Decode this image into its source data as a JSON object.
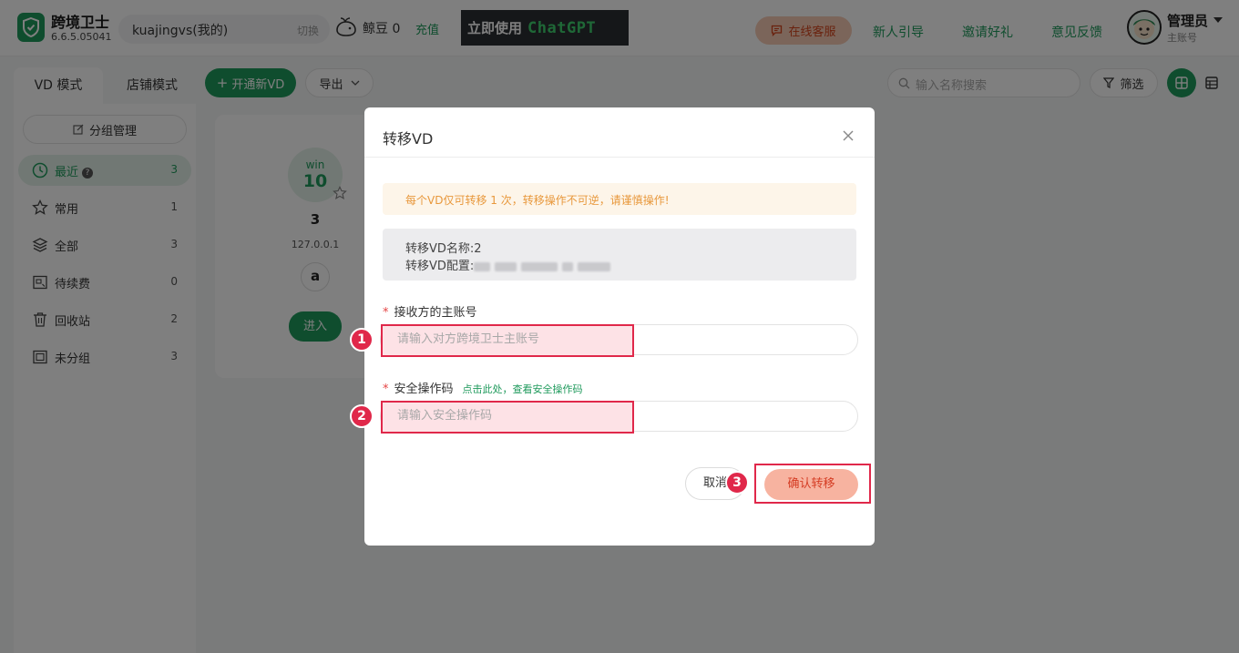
{
  "header": {
    "app_name": "跨境卫士",
    "version": "6.6.5.05041",
    "account_name": "kuajingvs(我的)",
    "account_switch": "切换",
    "jingdou_label": "鲸豆 0",
    "recharge": "充值",
    "banner_text_a": "立即使用",
    "banner_text_b": "ChatGPT",
    "service_label": "在线客服",
    "nav_links": [
      "新人引导",
      "邀请好礼",
      "意见反馈"
    ],
    "admin_name": "管理员",
    "admin_role": "主账号",
    "accent_color": "#1f9a5c"
  },
  "toolbar": {
    "tabs": [
      "VD 模式",
      "店铺模式"
    ],
    "new_vd": "开通新VD",
    "export": "导出",
    "search_placeholder": "输入名称搜索",
    "filter": "筛选"
  },
  "sidebar": {
    "group_manage": "分组管理",
    "items": [
      {
        "label": "最近",
        "count": "3",
        "icon": "clock-icon"
      },
      {
        "label": "常用",
        "count": "1",
        "icon": "star-icon"
      },
      {
        "label": "全部",
        "count": "3",
        "icon": "layers-icon"
      },
      {
        "label": "待续费",
        "count": "0",
        "icon": "renew-icon"
      },
      {
        "label": "回收站",
        "count": "2",
        "icon": "trash-icon"
      },
      {
        "label": "未分组",
        "count": "3",
        "icon": "folder-icon"
      }
    ]
  },
  "vd_card": {
    "os_name": "win",
    "os_version": "10",
    "name": "3",
    "ip": "127.0.0.1",
    "platform_icon": "amazon-icon",
    "enter": "进入"
  },
  "modal": {
    "title": "转移VD",
    "warning": "每个VD仅可转移 1 次，转移操作不可逆，请谨慎操作!",
    "info_name": "转移VD名称:2",
    "info_config_label": "转移VD配置:",
    "field1_label": "接收方的主账号",
    "field1_placeholder": "请输入对方跨境卫士主账号",
    "field1_value": "",
    "field2_label": "安全操作码",
    "field2_hint": "点击此处，查看安全操作码",
    "field2_placeholder": "请输入安全操作码",
    "field2_value": "",
    "cancel": "取消",
    "confirm": "确认转移",
    "required_mark": "*",
    "steps": [
      "1",
      "2",
      "3"
    ],
    "highlight_color": "#e0284a"
  }
}
